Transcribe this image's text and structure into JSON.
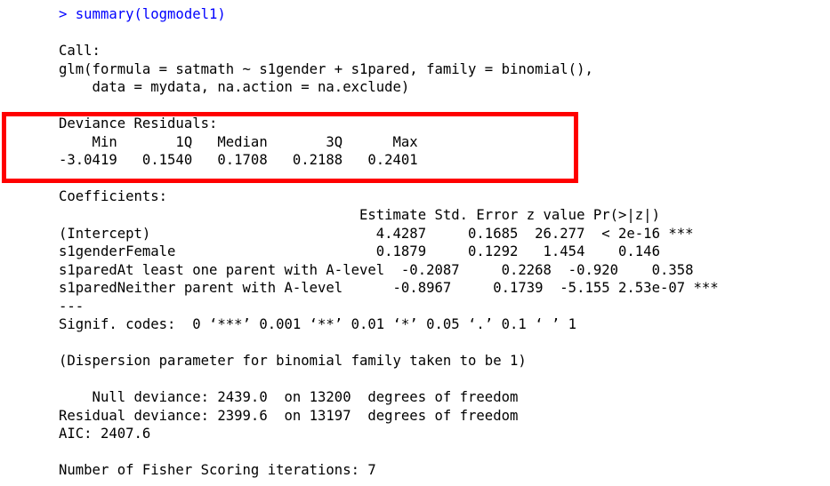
{
  "console": {
    "prompt": "> summary(logmodel1)",
    "call_header": "Call:",
    "call_line1": "glm(formula = satmath ~ s1gender + s1pared, family = binomial(),",
    "call_line2": "    data = mydata, na.action = na.exclude)",
    "dev_resid_header": "Deviance Residuals:",
    "dev_resid_labels": "    Min       1Q   Median       3Q      Max  ",
    "dev_resid_values": "-3.0419   0.1540   0.1708   0.2188   0.2401  ",
    "coef_header": "Coefficients:",
    "coef_col_header": "                                    Estimate Std. Error z value Pr(>|z|)    ",
    "coef_rows": [
      "(Intercept)                           4.4287     0.1685  26.277  < 2e-16 ***",
      "s1genderFemale                        0.1879     0.1292   1.454    0.146    ",
      "s1paredAt least one parent with A-level  -0.2087     0.2268  -0.920    0.358    ",
      "s1paredNeither parent with A-level      -0.8967     0.1739  -5.155 2.53e-07 ***"
    ],
    "separator": "---",
    "signif_codes": "Signif. codes:  0 ‘***’ 0.001 ‘**’ 0.01 ‘*’ 0.05 ‘.’ 0.1 ‘ ’ 1",
    "dispersion": "(Dispersion parameter for binomial family taken to be 1)",
    "null_deviance": "    Null deviance: 2439.0  on 13200  degrees of freedom",
    "residual_deviance": "Residual deviance: 2399.6  on 13197  degrees of freedom",
    "aic": "AIC: 2407.6",
    "fisher": "Number of Fisher Scoring iterations: 7"
  },
  "colors": {
    "prompt": "#0000ff",
    "text": "#000000",
    "highlight": "#ff0000"
  }
}
